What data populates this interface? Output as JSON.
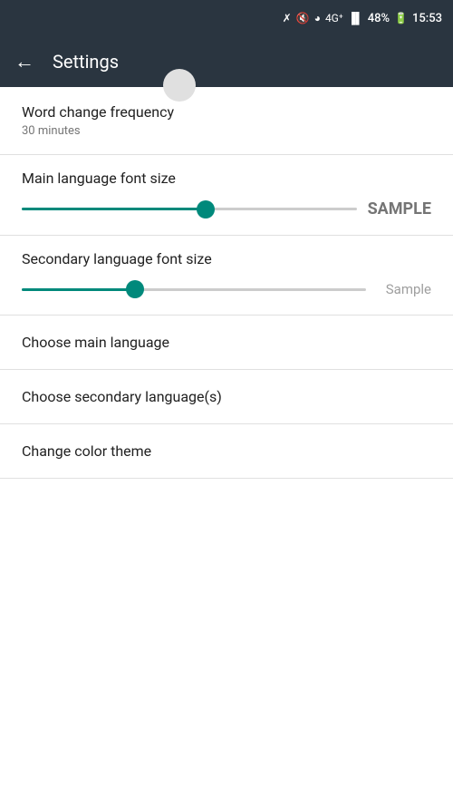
{
  "statusBar": {
    "battery": "48%",
    "time": "15:53",
    "icons": [
      "bluetooth",
      "mute",
      "alarm",
      "signal-4g",
      "signal-bars"
    ]
  },
  "appBar": {
    "backLabel": "←",
    "title": "Settings"
  },
  "settings": {
    "wordChangeFrequency": {
      "title": "Word change frequency",
      "subtitle": "30 minutes"
    },
    "mainLanguageFontSize": {
      "title": "Main language font size",
      "sampleText": "SAMPLE",
      "sliderValue": 55
    },
    "secondaryLanguageFontSize": {
      "title": "Secondary language font size",
      "sampleText": "Sample",
      "sliderValue": 33
    },
    "chooseMainLanguage": {
      "title": "Choose main language"
    },
    "chooseSecondaryLanguage": {
      "title": "Choose secondary language(s)"
    },
    "changeColorTheme": {
      "title": "Change color theme"
    }
  }
}
